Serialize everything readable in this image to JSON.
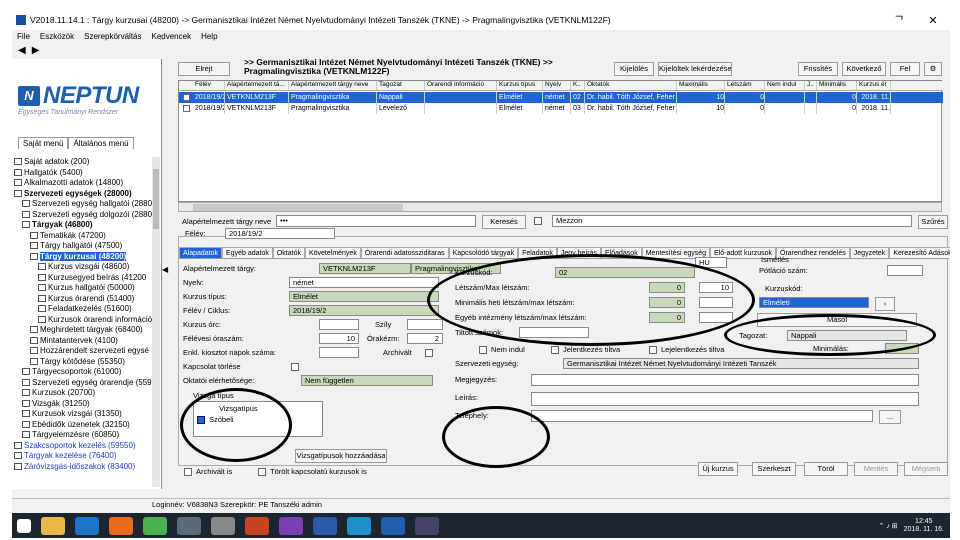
{
  "window": {
    "title": "V2018.11.14.1 : Tárgy kurzusai (48200) -> Germanisztikai Intézet Német Nyelvtudományi Intézeti Tanszék (TKNE) -> Pragmalingvisztika (VETKNLM122F)",
    "controls": [
      "ᄀ",
      "✕"
    ]
  },
  "menu": [
    "File",
    "Eszközök",
    "Szerepkörváltás",
    "Kedvencek",
    "Help"
  ],
  "logo": {
    "word": "NEPTUN",
    "slogan": "Egységes Tanulmányi Rendszer"
  },
  "lefttabs": [
    "Saját menü",
    "Általános menü"
  ],
  "tree": [
    {
      "t": "Saját adatok (200)",
      "b": false
    },
    {
      "t": "Hallgatók (5400)",
      "b": false
    },
    {
      "t": "Alkalmazotti adatok (14800)",
      "b": false
    },
    {
      "t": "Szervezeti egységek (28000)",
      "b": true
    },
    {
      "t": "Szervezeti egység hallgatói (2880",
      "b": false
    },
    {
      "t": "Szervezeti egység dolgozói (2880",
      "b": false
    },
    {
      "t": "Tárgyak (46800)",
      "b": true
    },
    {
      "t": "Tematikák (47200)",
      "b": false
    },
    {
      "t": "Tárgy hallgatói (47500)",
      "b": false
    },
    {
      "t": "Tárgy kurzusai (48200)",
      "b": true,
      "sel": true
    },
    {
      "t": "Kurzus vizsgái (48600)",
      "b": false
    },
    {
      "t": "Kurzusegyed beírás (41200",
      "b": false
    },
    {
      "t": "Kurzus hallgatói (50000)",
      "b": false
    },
    {
      "t": "Kurzus órarendi (51400)",
      "b": false
    },
    {
      "t": "Feladatkezelés (51600)",
      "b": false
    },
    {
      "t": "Kurzusok órarendi információ",
      "b": false
    },
    {
      "t": "Meghirdetett tárgyak (68400)",
      "b": false
    },
    {
      "t": "Mintatantervek (4100)",
      "b": false
    },
    {
      "t": "Hozzárendelt szervezeti egysé",
      "b": false
    },
    {
      "t": "Tárgy kötődése (55350)",
      "b": false
    },
    {
      "t": "Tárgyecsoportok (61000)",
      "b": false
    },
    {
      "t": "Szervezeti egység órarendje (559",
      "b": false
    },
    {
      "t": "Kurzusok (20700)",
      "b": false
    },
    {
      "t": "Vizsgák (31250)",
      "b": false
    },
    {
      "t": "Kurzusok vizsgái (31350)",
      "b": false
    },
    {
      "t": "Ebédidők üzenetek (32150)",
      "b": false
    },
    {
      "t": "Tárgyelemzésre (60850)",
      "b": false
    },
    {
      "t": "Szakcsoportok kezelés (59550)",
      "b": false,
      "blue": true
    },
    {
      "t": "Tárgyak kezelése (76400)",
      "b": false,
      "blue": true
    },
    {
      "t": "Záróvizsgás-időszakok (83400)",
      "b": false,
      "blue": true
    }
  ],
  "toolbar": {
    "hide": "Elrejt",
    "crumb": ">> Germanisztikai Intézet Német Nyelvtudományi Intézeti Tanszék (TKNE) >> Pragmalingvisztika (VETKNLM122F)",
    "copy": "Kijelölés",
    "copy_all": "Kijelöltek lekérdezése",
    "b1": "Frissítés",
    "b2": "Következő",
    "b3": "Fel"
  },
  "grid": {
    "headers": [
      "Félév",
      "Alapértelmezett tá...",
      "Alapértelmezett tárgy neve",
      "Tagozat",
      "Órarendi információ",
      "Kurzus típus",
      "Nyelv",
      "K..",
      "Oktatók",
      "Maximális",
      "Létszám",
      "Nem indul",
      "J..",
      "Minimális",
      "Kurzus ér"
    ],
    "rows": [
      [
        "2018/19/2",
        "VETKNLM213F",
        "Pragmalingvisztika",
        "Nappali",
        "",
        "Elmélet",
        "német",
        "02",
        "Dr. habil. Tóth József, Feher",
        "10",
        "0",
        "",
        "",
        "0",
        "2018. 11."
      ],
      [
        "2018/19/2",
        "VETKNLM213F",
        "Pragmalingvisztika",
        "Levelező",
        "",
        "Elmélet",
        "német",
        "03",
        "Dr. habil. Tóth József, Feher",
        "10",
        "0",
        "",
        "",
        "0",
        "2018. 11."
      ]
    ]
  },
  "filter": {
    "label": "Alapértelmezett tárgy neve",
    "value": "•••",
    "search": "Keresés",
    "select": "Mezzon",
    "clear": "Szűrés"
  },
  "detail": {
    "semester_label": "Félév:",
    "semester": "2018/19/2",
    "tabs": [
      "Alapadatok",
      "Egyéb adatok",
      "Oktatók",
      "Követelmények",
      "Órarendi adatossziditaras",
      "Kapcsolódó tárgyak",
      "Feladatok",
      "Jegy beírás",
      "Előadások",
      "Mentesítési egység",
      "Elő-adott kurzusok",
      "Órarendhez rendelés",
      "Jegyzetek",
      "Kerezesító Adások"
    ],
    "left": [
      {
        "l": "Alapértelmezett tárgy:",
        "v": "VETKNLM213F",
        "v2": "Pragmalingvisztika"
      },
      {
        "l": "Nyelv:",
        "v": "német"
      },
      {
        "l": "Kurzus típus:",
        "v": "Elmélet"
      },
      {
        "l": "Félév / Ciklus:",
        "v": "2018/19/2"
      },
      {
        "l": "Kurzus órc:",
        "v": "",
        "l2": "Szíly"
      },
      {
        "l": "Félévesi óraszám:",
        "v": "10",
        "l2": "Órakézm:",
        "v2": "2"
      },
      {
        "l": "Enkl. kiosztot napok száma:",
        "v": "",
        "l2": "Archivált"
      },
      {
        "l": "Kapcsolat törlése",
        "v": ""
      },
      {
        "l": "Oktatói elérhetősége:",
        "v": "Nem független"
      }
    ],
    "exam_label": "Vizsga típus",
    "exam_items": [
      "Vizsgatípus",
      "Szóbeli"
    ],
    "mid": [
      {
        "l": "Kurzuskód:",
        "v": "02"
      },
      {
        "l": "Létszám/Max létszám:",
        "v": "0",
        "v2": "10"
      },
      {
        "l": "Minimális heti létszám/max létszám:",
        "v": "0"
      },
      {
        "l": "Egyéb intézmény létszám/max létszám:",
        "v": "0"
      },
      {
        "l": "Tiltott számok:",
        "v": ""
      }
    ],
    "lang_code": "HU",
    "right": {
      "repeat_label": "Ismétlés",
      "count_label": "Pótláció szám:",
      "course_label": "Kurzuskód:",
      "course_val": "Elméleti",
      "more": "Másol",
      "mode_label": "Tagozat:",
      "mode_val": "Nappali",
      "min_label": "Minimálás:"
    },
    "row_flags": [
      "Nem indul",
      "Jelentkezés tiltva",
      "Lejelentkezés tiltva"
    ],
    "org_label": "Szervezeti egység:",
    "org_val": "Germanisztikai Intézet Német Nyelvtudományi Intézeti Tanszék",
    "more_labels": [
      "Megjegyzés:",
      "Leírás:",
      "Telephely:"
    ],
    "add_exam": "Vizsgatípusok hozzáadása"
  },
  "bottom": {
    "archived": "Archivált is",
    "archived2": "Törölt kapcsolatú kurzusok is",
    "b_new": "Új kurzus",
    "b_edit": "Szerkeszt",
    "b_del": "Töröl",
    "b_save": "Mentés",
    "b_cancel": "Mégsem"
  },
  "status": "Loginnév: V6838N3   Szerepkör: PE Tanszéki admin",
  "taskbar": {
    "time": "12:45",
    "date": "2018. 11. 16."
  }
}
